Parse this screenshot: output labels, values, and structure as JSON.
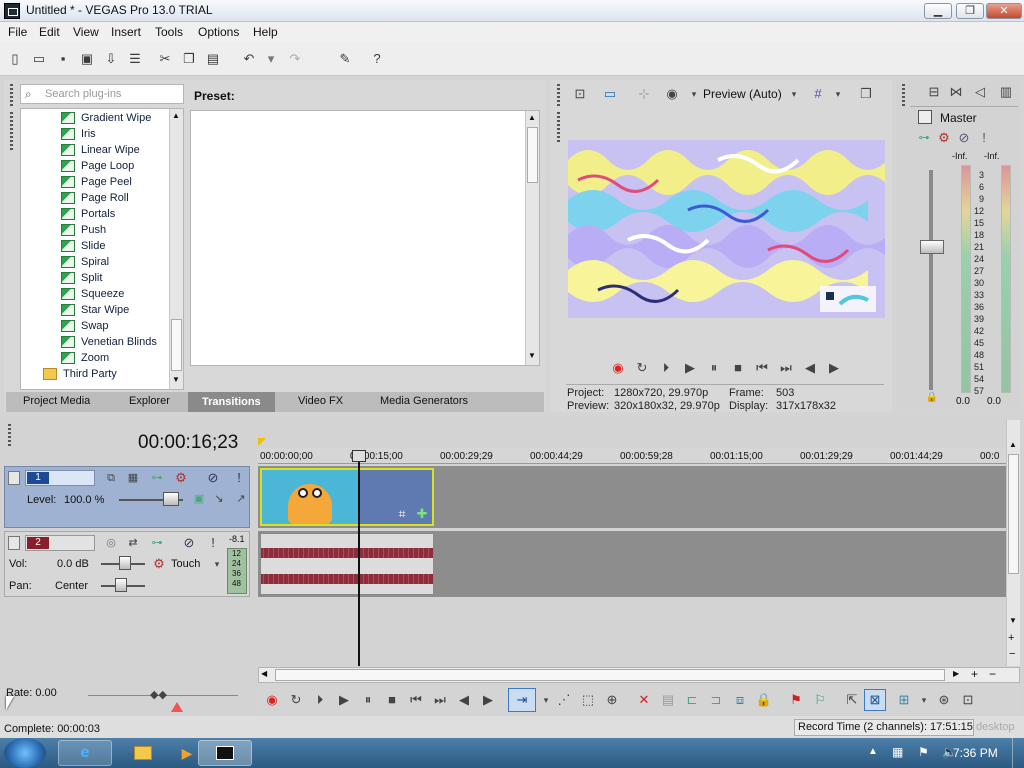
{
  "window": {
    "title": "Untitled * - VEGAS Pro 13.0 TRIAL",
    "min": "▁",
    "max": "❐",
    "close": "✕"
  },
  "menu": [
    "File",
    "Edit",
    "View",
    "Insert",
    "Tools",
    "Options",
    "Help"
  ],
  "toolbar_icons": [
    "new-icon",
    "open-icon",
    "save-icon",
    "save-as-icon",
    "render-icon",
    "properties-icon",
    "cut-icon",
    "copy-icon",
    "paste-icon",
    "undo-icon",
    "redo-icon",
    "clean-icon",
    "help-icon"
  ],
  "explorer": {
    "search_placeholder": "Search plug-ins",
    "preset_label": "Preset:",
    "items": [
      "Gradient Wipe",
      "Iris",
      "Linear Wipe",
      "Page Loop",
      "Page Peel",
      "Page Roll",
      "Portals",
      "Push",
      "Slide",
      "Spiral",
      "Split",
      "Squeeze",
      "Star Wipe",
      "Swap",
      "Venetian Blinds",
      "Zoom"
    ],
    "folder": "Third Party",
    "tabs": [
      "Project Media",
      "Explorer",
      "Transitions",
      "Video FX",
      "Media Generators"
    ],
    "active_tab": "Transitions"
  },
  "preview": {
    "mode": "Preview (Auto)",
    "project_label": "Project:",
    "project_value": "1280x720, 29.970p",
    "preview_label": "Preview:",
    "preview_value": "320x180x32, 29.970p",
    "frame_label": "Frame:",
    "frame_value": "503",
    "display_label": "Display:",
    "display_value": "317x178x32"
  },
  "master": {
    "label": "Master",
    "left_inf": "-Inf.",
    "right_inf": "-Inf.",
    "scale": [
      "3",
      "6",
      "9",
      "12",
      "15",
      "18",
      "21",
      "24",
      "27",
      "30",
      "33",
      "36",
      "39",
      "42",
      "45",
      "48",
      "51",
      "54",
      "57"
    ],
    "left_val": "0.0",
    "right_val": "0.0"
  },
  "timeline": {
    "timecode": "00:00:16;23",
    "ruler": [
      "00:00:00;00",
      "00:00:15;00",
      "00:00:29;29",
      "00:00:44;29",
      "00:00:59;28",
      "00:01:15;00",
      "00:01:29;29",
      "00:01:44;29",
      "00:0"
    ],
    "track1": {
      "number": "1",
      "level_label": "Level:",
      "level_value": "100.0 %"
    },
    "track2": {
      "number": "2",
      "vol_label": "Vol:",
      "vol_value": "0.0 dB",
      "pan_label": "Pan:",
      "pan_value": "Center",
      "automation": "Touch",
      "meter_top": "-8.1",
      "meter_scale": [
        "12",
        "24",
        "36",
        "48"
      ]
    }
  },
  "rate": "Rate: 0.00",
  "status": {
    "complete": "Complete: 00:00:03",
    "record_time": "Record Time (2 channels): 17:51:15",
    "desktop": "desktop"
  },
  "taskbar": {
    "clock": "7:36 PM"
  }
}
